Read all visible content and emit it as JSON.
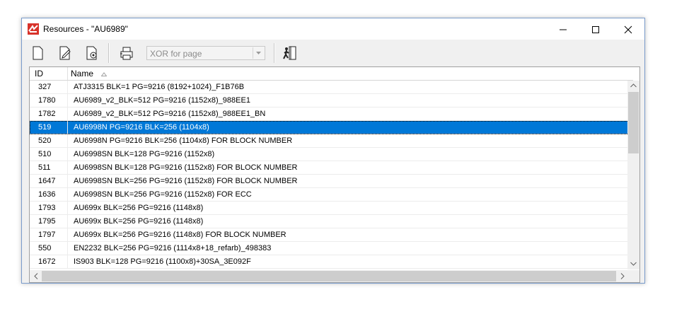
{
  "window": {
    "title": "Resources - \"AU6989\""
  },
  "toolbar": {
    "combo_value": "XOR for page"
  },
  "columns": {
    "id": "ID",
    "name": "Name"
  },
  "rows": [
    {
      "id": "327",
      "name": "ATJ3315 BLK=1 PG=9216 (8192+1024)_F1B76B"
    },
    {
      "id": "1780",
      "name": "AU6989_v2_BLK=512 PG=9216 (1152x8)_988EE1"
    },
    {
      "id": "1782",
      "name": "AU6989_v2_BLK=512 PG=9216 (1152x8)_988EE1_BN"
    },
    {
      "id": "519",
      "name": "AU6998N PG=9216 BLK=256 (1104x8)"
    },
    {
      "id": "520",
      "name": "AU6998N PG=9216 BLK=256 (1104x8) FOR BLOCK NUMBER"
    },
    {
      "id": "510",
      "name": "AU6998SN BLK=128 PG=9216 (1152x8)"
    },
    {
      "id": "511",
      "name": "AU6998SN BLK=128 PG=9216 (1152x8) FOR BLOCK NUMBER"
    },
    {
      "id": "1647",
      "name": "AU6998SN BLK=256 PG=9216 (1152x8) FOR BLOCK NUMBER"
    },
    {
      "id": "1636",
      "name": "AU6998SN BLK=256 PG=9216 (1152x8) FOR ECC"
    },
    {
      "id": "1793",
      "name": "AU699x BLK=256 PG=9216 (1148x8)"
    },
    {
      "id": "1795",
      "name": "AU699x BLK=256 PG=9216 (1148x8)"
    },
    {
      "id": "1797",
      "name": "AU699x BLK=256 PG=9216 (1148x8) FOR BLOCK NUMBER"
    },
    {
      "id": "550",
      "name": "EN2232 BLK=256 PG=9216 (1114x8+18_refarb)_498383"
    },
    {
      "id": "1672",
      "name": "IS903 BLK=128 PG=9216 (1100x8)+30SA_3E092F"
    }
  ],
  "selected_row_index": 3,
  "colors": {
    "selection": "#0078d7",
    "titlebar": "#ffffff",
    "chrome": "#f0f0f0"
  },
  "icons": [
    "app-icon",
    "minimize-icon",
    "maximize-icon",
    "close-icon",
    "new-document-icon",
    "edit-document-icon",
    "settings-document-icon",
    "print-icon",
    "dropdown-arrow-icon",
    "exit-icon",
    "sort-ascending-icon"
  ]
}
